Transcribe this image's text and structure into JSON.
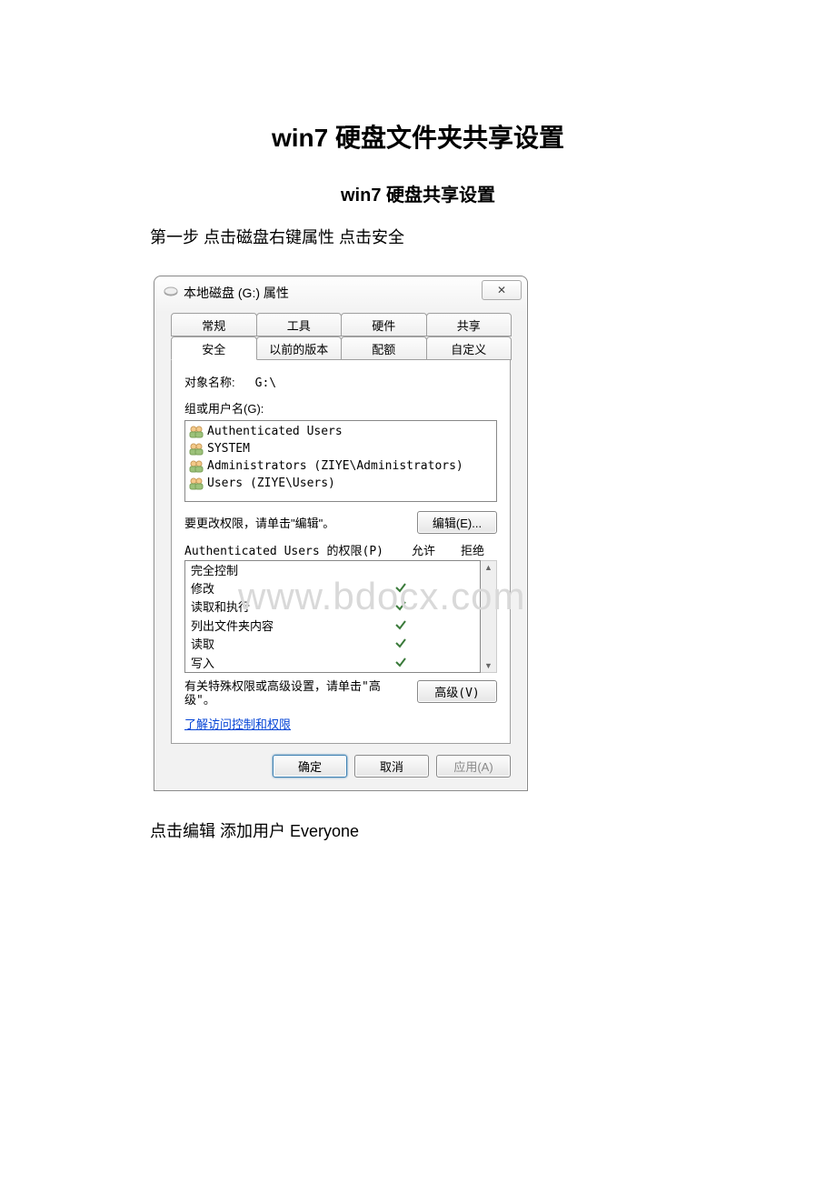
{
  "doc": {
    "title": "win7 硬盘文件夹共享设置",
    "subtitle": "win7 硬盘共享设置",
    "step1": "第一步 点击磁盘右键属性 点击安全",
    "note": "点击编辑 添加用户 Everyone"
  },
  "dialog": {
    "title": "本地磁盘 (G:) 属性",
    "tabs_row1": [
      "常规",
      "工具",
      "硬件",
      "共享"
    ],
    "tabs_row2": [
      "安全",
      "以前的版本",
      "配额",
      "自定义"
    ],
    "active_tab": "安全",
    "object_name_label": "对象名称:",
    "object_name_value": "G:\\",
    "group_users_label": "组或用户名(G):",
    "users": [
      "Authenticated Users",
      "SYSTEM",
      "Administrators (ZIYE\\Administrators)",
      "Users (ZIYE\\Users)"
    ],
    "edit_hint": "要更改权限，请单击\"编辑\"。",
    "edit_btn": "编辑(E)...",
    "perm_label": "Authenticated Users 的权限(P)",
    "allow_label": "允许",
    "deny_label": "拒绝",
    "permissions": [
      {
        "name": "完全控制",
        "allow": false
      },
      {
        "name": "修改",
        "allow": true
      },
      {
        "name": "读取和执行",
        "allow": true
      },
      {
        "name": "列出文件夹内容",
        "allow": true
      },
      {
        "name": "读取",
        "allow": true
      },
      {
        "name": "写入",
        "allow": true
      }
    ],
    "adv_hint": "有关特殊权限或高级设置，请单击\"高级\"。",
    "adv_btn": "高级(V)",
    "link": "了解访问控制和权限",
    "ok_btn": "确定",
    "cancel_btn": "取消",
    "apply_btn": "应用(A)",
    "close": "✕",
    "scroll_up": "▲",
    "scroll_down": "▼"
  },
  "watermark": "www.bdocx.com"
}
